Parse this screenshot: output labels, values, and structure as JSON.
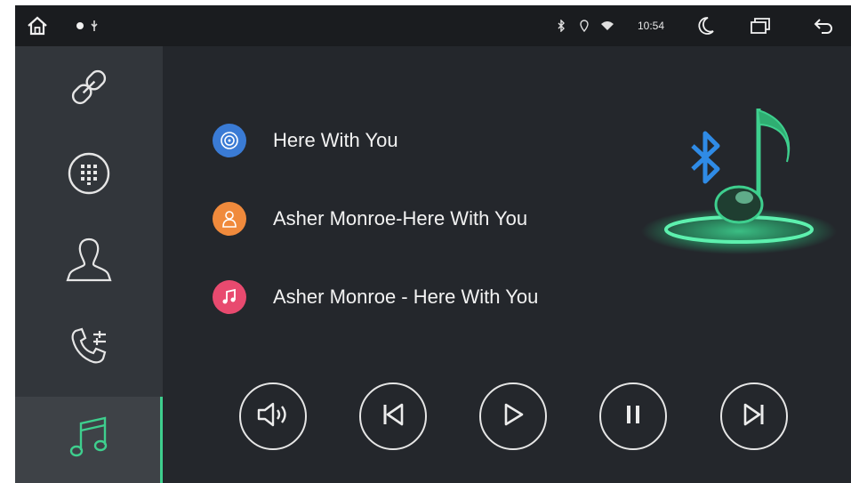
{
  "status_bar": {
    "time": "10:54",
    "icons": [
      "home-icon",
      "notification-dot-icon",
      "usb-icon",
      "bluetooth-icon",
      "location-icon",
      "wifi-icon",
      "night-mode-icon",
      "recent-apps-icon",
      "back-icon"
    ]
  },
  "sidebar": {
    "items": [
      {
        "name": "link",
        "icon": "link-icon"
      },
      {
        "name": "dialpad",
        "icon": "dialpad-icon"
      },
      {
        "name": "contacts",
        "icon": "contact-icon"
      },
      {
        "name": "call-settings",
        "icon": "call-settings-icon"
      },
      {
        "name": "music",
        "icon": "music-icon",
        "active": true
      }
    ]
  },
  "track_info": {
    "album": "Here With You",
    "artist": "Asher Monroe-Here With You",
    "title": "Asher Monroe - Here With You"
  },
  "controls": [
    {
      "name": "volume",
      "icon": "volume-icon"
    },
    {
      "name": "previous",
      "icon": "previous-track-icon"
    },
    {
      "name": "play",
      "icon": "play-icon"
    },
    {
      "name": "pause",
      "icon": "pause-icon"
    },
    {
      "name": "next",
      "icon": "next-track-icon"
    }
  ],
  "colors": {
    "accent_green": "#3ecf8e",
    "album_icon": "#3a7bd5",
    "artist_icon": "#f08a3c",
    "title_icon": "#e84a6f",
    "bluetooth": "#2f8be6"
  }
}
